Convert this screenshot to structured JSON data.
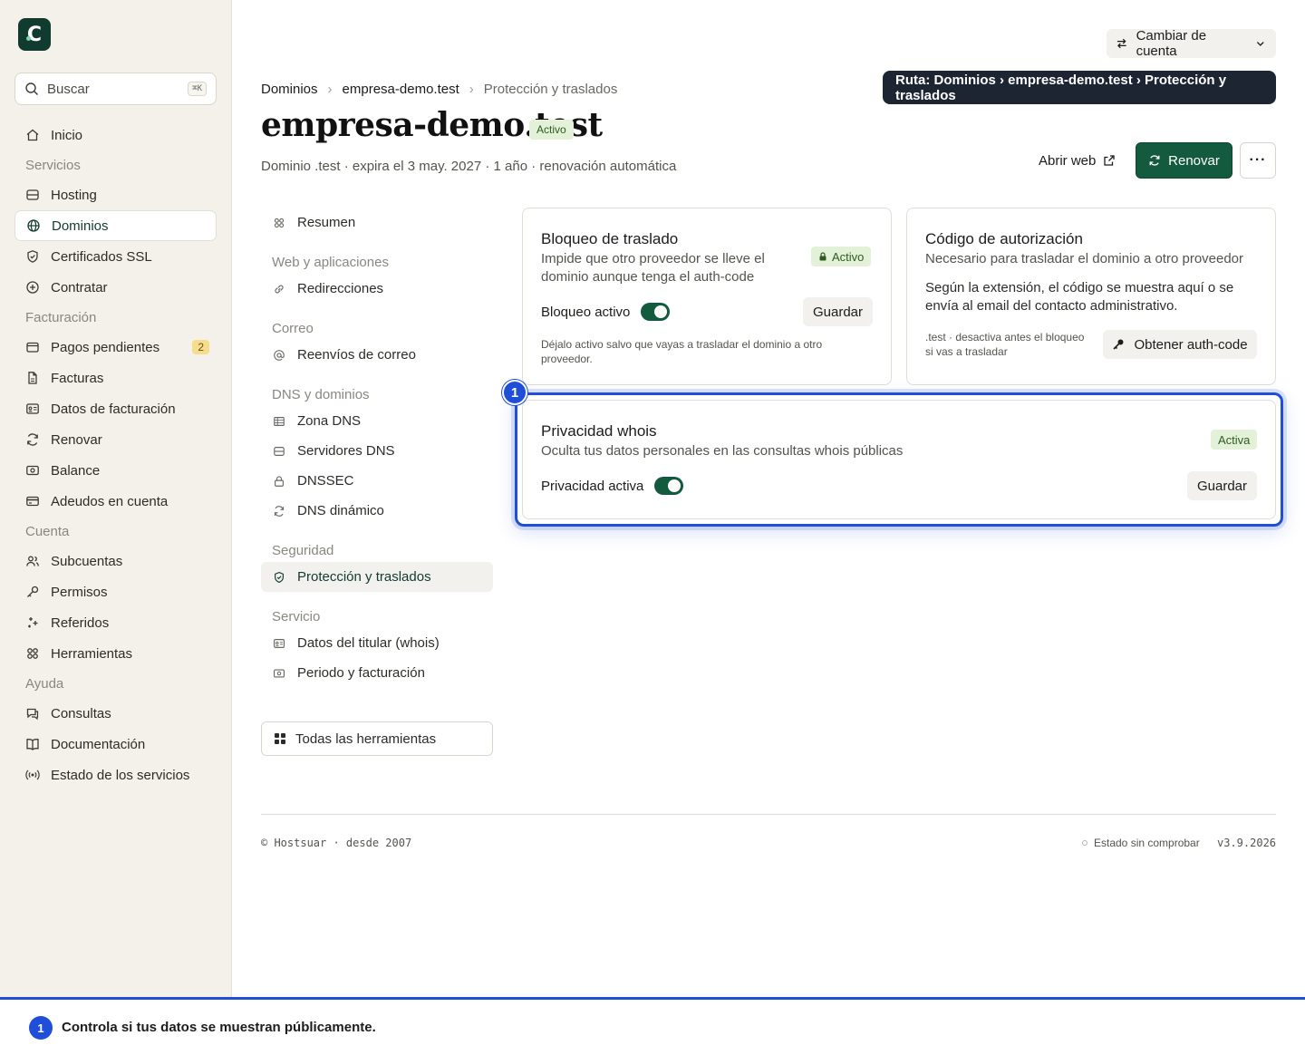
{
  "sidebar": {
    "logo": "C",
    "search": {
      "placeholder": "Buscar",
      "shortcut": "⌘K"
    },
    "items": [
      {
        "type": "item",
        "label": "Inicio",
        "icon": "home-icon"
      },
      {
        "type": "group",
        "label": "Servicios"
      },
      {
        "type": "item",
        "label": "Hosting",
        "icon": "server-icon"
      },
      {
        "type": "item",
        "label": "Dominios",
        "icon": "globe-icon",
        "active": true
      },
      {
        "type": "item",
        "label": "Certificados SSL",
        "icon": "shield-icon"
      },
      {
        "type": "item",
        "label": "Contratar",
        "icon": "plus-circle-icon"
      },
      {
        "type": "group",
        "label": "Facturación"
      },
      {
        "type": "item",
        "label": "Pagos pendientes",
        "icon": "wallet-icon",
        "badge": "2"
      },
      {
        "type": "item",
        "label": "Facturas",
        "icon": "file-icon"
      },
      {
        "type": "item",
        "label": "Datos de facturación",
        "icon": "id-card-icon"
      },
      {
        "type": "item",
        "label": "Renovar",
        "icon": "refresh-icon"
      },
      {
        "type": "item",
        "label": "Balance",
        "icon": "banknote-icon"
      },
      {
        "type": "item",
        "label": "Adeudos en cuenta",
        "icon": "credit-card-icon"
      },
      {
        "type": "group",
        "label": "Cuenta"
      },
      {
        "type": "item",
        "label": "Subcuentas",
        "icon": "users-icon"
      },
      {
        "type": "item",
        "label": "Permisos",
        "icon": "key-icon"
      },
      {
        "type": "item",
        "label": "Referidos",
        "icon": "sparkles-icon"
      },
      {
        "type": "item",
        "label": "Herramientas",
        "icon": "grid-icon"
      },
      {
        "type": "group",
        "label": "Ayuda"
      },
      {
        "type": "item",
        "label": "Consultas",
        "icon": "chat-icon"
      },
      {
        "type": "item",
        "label": "Documentación",
        "icon": "book-icon"
      },
      {
        "type": "item",
        "label": "Estado de los servicios",
        "icon": "broadcast-icon"
      }
    ]
  },
  "header": {
    "account_switch": "Cambiar de cuenta",
    "tooltip": "Ruta: Dominios › empresa-demo.test › Protección y traslados",
    "breadcrumb": [
      "Dominios",
      "empresa-demo.test",
      "Protección y traslados"
    ],
    "title": "empresa-demo.test",
    "status": "Activo",
    "subtitle": "Dominio .test · expira el 3 may. 2027 · 1 año · renovación automática",
    "open_web": "Abrir web",
    "renew": "Renovar",
    "more": "···"
  },
  "subnav": {
    "items": [
      {
        "type": "item",
        "label": "Resumen",
        "icon": "grid-icon"
      },
      {
        "type": "group",
        "label": "Web y aplicaciones"
      },
      {
        "type": "item",
        "label": "Redirecciones",
        "icon": "link-icon"
      },
      {
        "type": "group",
        "label": "Correo"
      },
      {
        "type": "item",
        "label": "Reenvíos de correo",
        "icon": "at-icon"
      },
      {
        "type": "group",
        "label": "DNS y dominios"
      },
      {
        "type": "item",
        "label": "Zona DNS",
        "icon": "table-icon"
      },
      {
        "type": "item",
        "label": "Servidores DNS",
        "icon": "server-icon"
      },
      {
        "type": "item",
        "label": "DNSSEC",
        "icon": "lock-icon"
      },
      {
        "type": "item",
        "label": "DNS dinámico",
        "icon": "refresh-icon"
      },
      {
        "type": "group",
        "label": "Seguridad"
      },
      {
        "type": "item",
        "label": "Protección y traslados",
        "icon": "shield-icon",
        "active": true
      },
      {
        "type": "group",
        "label": "Servicio"
      },
      {
        "type": "item",
        "label": "Datos del titular (whois)",
        "icon": "id-card-icon"
      },
      {
        "type": "item",
        "label": "Periodo y facturación",
        "icon": "banknote-icon"
      }
    ],
    "all_tools": "Todas las herramientas"
  },
  "cards": {
    "transfer_lock": {
      "title": "Bloqueo de traslado",
      "description": "Impide que otro proveedor se lleve el dominio aunque tenga el auth-code",
      "status": "Activo",
      "toggle_label": "Bloqueo activo",
      "toggle_on": true,
      "save": "Guardar",
      "note": "Déjalo activo salvo que vayas a trasladar el dominio a otro proveedor."
    },
    "auth_code": {
      "title": "Código de autorización",
      "description": "Necesario para trasladar el dominio a otro proveedor",
      "info": "Según la extensión, el código se muestra aquí o se envía al email del contacto administrativo.",
      "note": ".test · desactiva antes el bloqueo si vas a trasladar",
      "button": "Obtener auth-code"
    },
    "whois_privacy": {
      "title": "Privacidad whois",
      "description": "Oculta tus datos personales en las consultas whois públicas",
      "status": "Activa",
      "toggle_label": "Privacidad activa",
      "toggle_on": true,
      "save": "Guardar",
      "marker": "1"
    }
  },
  "footer": {
    "copyright": "© Hostsuar · desde 2007",
    "status": "Estado sin comprobar",
    "version": "v3.9.2026"
  },
  "callout": {
    "marker": "1",
    "text": "Controla si tus datos se muestran públicamente."
  },
  "colors": {
    "brand": "#145a3e",
    "accent": "#1f4ed8",
    "sidebar_bg": "#f4f1ea"
  }
}
